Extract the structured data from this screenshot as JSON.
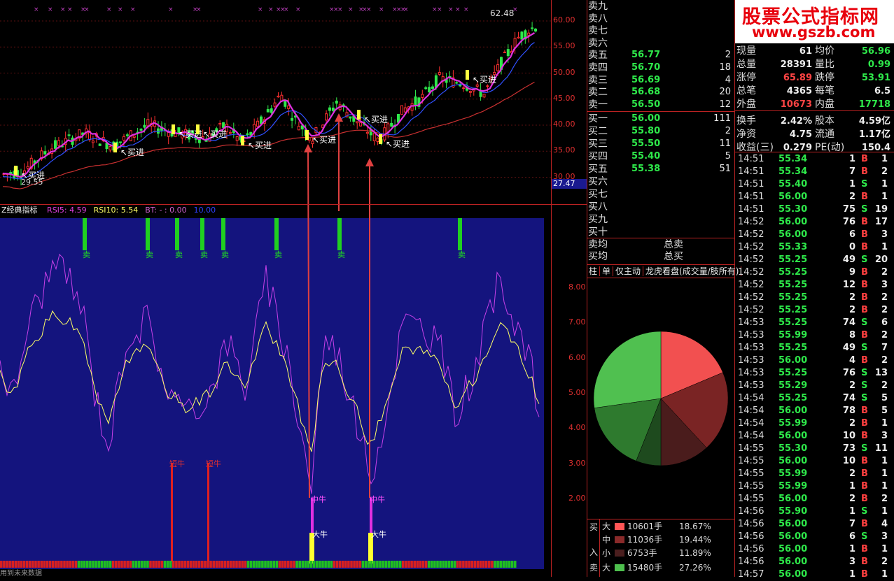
{
  "watermark": {
    "title": "股票公式指标网",
    "url": "www.gszb.com"
  },
  "main_chart": {
    "high_label": "62.48",
    "y_ticks": [
      "60.00",
      "55.00",
      "50.00",
      "45.00",
      "40.00",
      "35.00",
      "30.00"
    ],
    "current_price_box": "27.47",
    "buy_signal_label": "买进",
    "low_label": "29.55"
  },
  "indicator_panel": {
    "title": "Z经典指标",
    "params": [
      {
        "text": "RSI5: 4.59",
        "color": "#e040e0"
      },
      {
        "text": "RSI10: 5.54",
        "color": "#ffff66"
      },
      {
        "text": "BT: -  : 0.00",
        "color": "#d060d0"
      },
      {
        "text": "10.00",
        "color": "#3040ff"
      }
    ],
    "y_ticks": [
      "8.00",
      "7.00",
      "6.00",
      "5.00",
      "4.00",
      "3.00",
      "2.00"
    ],
    "sell_label": "卖",
    "short_bull_label": "短牛",
    "mid_bull_label": "中牛",
    "big_bull_label": "大牛",
    "footer_text": "用到未来数据"
  },
  "order_book": {
    "sells": [
      {
        "label": "卖九",
        "price": "",
        "vol": ""
      },
      {
        "label": "卖八",
        "price": "",
        "vol": ""
      },
      {
        "label": "卖七",
        "price": "",
        "vol": ""
      },
      {
        "label": "卖六",
        "price": "",
        "vol": ""
      },
      {
        "label": "卖五",
        "price": "56.77",
        "vol": "2"
      },
      {
        "label": "卖四",
        "price": "56.70",
        "vol": "18"
      },
      {
        "label": "卖三",
        "price": "56.69",
        "vol": "4"
      },
      {
        "label": "卖二",
        "price": "56.68",
        "vol": "20"
      },
      {
        "label": "卖一",
        "price": "56.50",
        "vol": "12"
      }
    ],
    "buys": [
      {
        "label": "买一",
        "price": "56.00",
        "vol": "111"
      },
      {
        "label": "买二",
        "price": "55.80",
        "vol": "2"
      },
      {
        "label": "买三",
        "price": "55.50",
        "vol": "11"
      },
      {
        "label": "买四",
        "price": "55.40",
        "vol": "5"
      },
      {
        "label": "买五",
        "price": "55.38",
        "vol": "51"
      },
      {
        "label": "买六",
        "price": "",
        "vol": ""
      },
      {
        "label": "买七",
        "price": "",
        "vol": ""
      },
      {
        "label": "买八",
        "price": "",
        "vol": ""
      },
      {
        "label": "买九",
        "price": "",
        "vol": ""
      },
      {
        "label": "买十",
        "price": "",
        "vol": ""
      }
    ],
    "avg_sell_label": "卖均",
    "total_sell_label": "总卖",
    "avg_buy_label": "买均",
    "total_buy_label": "总买",
    "tabs": [
      "柱",
      "单",
      "仅主动",
      "龙虎看盘(成交量/肢所有)"
    ]
  },
  "stats": [
    {
      "k1": "现量",
      "v1": "61",
      "c1": "#eeeeee",
      "k2": "均价",
      "v2": "56.96",
      "c2": "#2ee84a"
    },
    {
      "k1": "总量",
      "v1": "28391",
      "c1": "#eeeeee",
      "k2": "量比",
      "v2": "0.99",
      "c2": "#2ee84a"
    },
    {
      "k1": "涨停",
      "v1": "65.89",
      "c1": "#ff4444",
      "k2": "跌停",
      "v2": "53.91",
      "c2": "#2ee84a"
    },
    {
      "k1": "总笔",
      "v1": "4365",
      "c1": "#eeeeee",
      "k2": "每笔",
      "v2": "6.5",
      "c2": "#eeeeee"
    },
    {
      "k1": "外盘",
      "v1": "10673",
      "c1": "#ff4444",
      "k2": "内盘",
      "v2": "17718",
      "c2": "#2ee84a"
    },
    {
      "k1": "换手",
      "v1": "2.42%",
      "c1": "#eeeeee",
      "k2": "股本",
      "v2": "4.59亿",
      "c2": "#eeeeee"
    },
    {
      "k1": "净资",
      "v1": "4.75",
      "c1": "#eeeeee",
      "k2": "流通",
      "v2": "1.17亿",
      "c2": "#eeeeee"
    },
    {
      "k1": "收益(三)",
      "v1": "0.279",
      "c1": "#eeeeee",
      "k2": "PE(动)",
      "v2": "150.4",
      "c2": "#eeeeee"
    }
  ],
  "ticks": [
    {
      "t": "14:51",
      "p": "55.34",
      "v": "1",
      "bs": "B",
      "n": "1"
    },
    {
      "t": "14:51",
      "p": "55.34",
      "v": "7",
      "bs": "B",
      "n": "2"
    },
    {
      "t": "14:51",
      "p": "55.40",
      "v": "1",
      "bs": "S",
      "n": "1"
    },
    {
      "t": "14:51",
      "p": "56.00",
      "v": "2",
      "bs": "B",
      "n": "1"
    },
    {
      "t": "14:51",
      "p": "55.30",
      "v": "75",
      "bs": "S",
      "n": "19"
    },
    {
      "t": "14:52",
      "p": "56.00",
      "v": "76",
      "bs": "B",
      "n": "17"
    },
    {
      "t": "14:52",
      "p": "56.00",
      "v": "6",
      "bs": "B",
      "n": "3"
    },
    {
      "t": "14:52",
      "p": "55.33",
      "v": "0",
      "bs": "B",
      "n": "1"
    },
    {
      "t": "14:52",
      "p": "55.25",
      "v": "49",
      "bs": "S",
      "n": "20"
    },
    {
      "t": "14:52",
      "p": "55.25",
      "v": "9",
      "bs": "B",
      "n": "2"
    },
    {
      "t": "14:52",
      "p": "55.25",
      "v": "12",
      "bs": "B",
      "n": "3"
    },
    {
      "t": "14:52",
      "p": "55.25",
      "v": "2",
      "bs": "B",
      "n": "2"
    },
    {
      "t": "14:52",
      "p": "55.25",
      "v": "2",
      "bs": "B",
      "n": "2"
    },
    {
      "t": "14:53",
      "p": "55.25",
      "v": "74",
      "bs": "S",
      "n": "6"
    },
    {
      "t": "14:53",
      "p": "55.99",
      "v": "8",
      "bs": "B",
      "n": "2"
    },
    {
      "t": "14:53",
      "p": "55.25",
      "v": "49",
      "bs": "S",
      "n": "7"
    },
    {
      "t": "14:53",
      "p": "56.00",
      "v": "4",
      "bs": "B",
      "n": "2"
    },
    {
      "t": "14:53",
      "p": "55.25",
      "v": "76",
      "bs": "S",
      "n": "13"
    },
    {
      "t": "14:53",
      "p": "55.29",
      "v": "2",
      "bs": "S",
      "n": "2"
    },
    {
      "t": "14:54",
      "p": "55.25",
      "v": "74",
      "bs": "S",
      "n": "5"
    },
    {
      "t": "14:54",
      "p": "56.00",
      "v": "78",
      "bs": "B",
      "n": "5"
    },
    {
      "t": "14:54",
      "p": "55.99",
      "v": "2",
      "bs": "B",
      "n": "1"
    },
    {
      "t": "14:54",
      "p": "56.00",
      "v": "10",
      "bs": "B",
      "n": "3"
    },
    {
      "t": "14:55",
      "p": "55.30",
      "v": "73",
      "bs": "S",
      "n": "11"
    },
    {
      "t": "14:55",
      "p": "56.00",
      "v": "10",
      "bs": "B",
      "n": "1"
    },
    {
      "t": "14:55",
      "p": "55.99",
      "v": "2",
      "bs": "B",
      "n": "1"
    },
    {
      "t": "14:55",
      "p": "55.99",
      "v": "1",
      "bs": "B",
      "n": "1"
    },
    {
      "t": "14:55",
      "p": "56.00",
      "v": "2",
      "bs": "B",
      "n": "2"
    },
    {
      "t": "14:56",
      "p": "55.90",
      "v": "1",
      "bs": "S",
      "n": "1"
    },
    {
      "t": "14:56",
      "p": "56.00",
      "v": "7",
      "bs": "B",
      "n": "4"
    },
    {
      "t": "14:56",
      "p": "56.00",
      "v": "6",
      "bs": "S",
      "n": "3"
    },
    {
      "t": "14:56",
      "p": "56.00",
      "v": "1",
      "bs": "B",
      "n": "1"
    },
    {
      "t": "14:56",
      "p": "56.00",
      "v": "3",
      "bs": "B",
      "n": "2"
    },
    {
      "t": "14:57",
      "p": "56.00",
      "v": "1",
      "bs": "B",
      "n": "1"
    }
  ],
  "money_flow": {
    "buy_side_label": "买",
    "buy_side_label2": "入",
    "sell_side_label": "卖",
    "rows": [
      {
        "size": "大",
        "vol": "10601手",
        "pct": "18.67%",
        "color": "#ff5555"
      },
      {
        "size": "中",
        "vol": "11036手",
        "pct": "19.44%",
        "color": "#8a2a2a"
      },
      {
        "size": "小",
        "vol": "6753手",
        "pct": "11.89%",
        "color": "#4a1e1e"
      },
      {
        "size": "大",
        "vol": "15480手",
        "pct": "27.26%",
        "color": "#4ec04e"
      }
    ]
  },
  "pie": {
    "slices": [
      {
        "name": "买大",
        "pct": 18.67,
        "color": "#f25050"
      },
      {
        "name": "买中",
        "pct": 19.44,
        "color": "#7a2424"
      },
      {
        "name": "买小",
        "pct": 11.89,
        "color": "#4a1c1c"
      },
      {
        "name": "卖小",
        "pct": 6.0,
        "color": "#1e4a1e"
      },
      {
        "name": "卖中",
        "pct": 16.74,
        "color": "#2e7a2e"
      },
      {
        "name": "卖大",
        "pct": 27.26,
        "color": "#50c050"
      }
    ]
  }
}
